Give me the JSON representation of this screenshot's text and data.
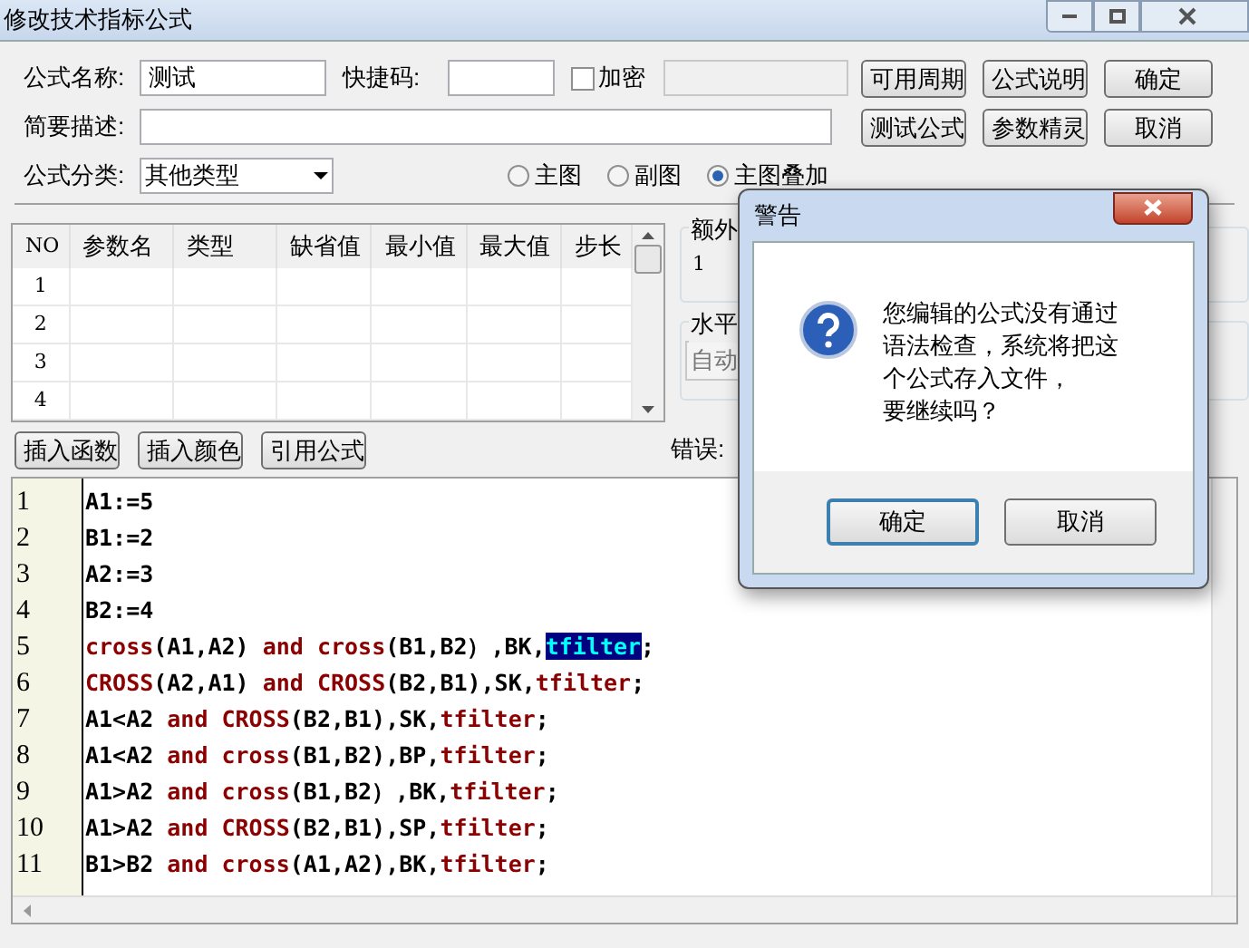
{
  "window": {
    "title": "修改技术指标公式"
  },
  "form": {
    "name_label": "公式名称:",
    "name_value": "测试",
    "shortcut_label": "快捷码:",
    "encrypt": {
      "label": "加密",
      "checked": false
    },
    "desc_label": "简要描述:",
    "category_label": "公式分类:",
    "category_value": "其他类型",
    "chart_types": [
      {
        "label": "主图",
        "selected": false
      },
      {
        "label": "副图",
        "selected": false
      },
      {
        "label": "主图叠加",
        "selected": true
      }
    ]
  },
  "buttons": [
    "可用周期",
    "公式说明",
    "确定",
    "测试公式",
    "参数精灵",
    "取消"
  ],
  "param_table": {
    "columns": [
      "NO",
      "参数名",
      "类型",
      "缺省值",
      "最小值",
      "最大值",
      "步长"
    ],
    "rows": [
      "1",
      "2",
      "3",
      "4"
    ]
  },
  "side": {
    "extra_label": "额外",
    "extra_value": "1",
    "horizontal_label": "水平",
    "auto_value": "自动",
    "error_label": "错误:"
  },
  "insert_buttons": [
    "插入函数",
    "插入颜色",
    "引用公式"
  ],
  "editor": {
    "lines": [
      {
        "number": "1",
        "tokens": [
          {
            "text": "A1:=5",
            "kind": "plain"
          }
        ]
      },
      {
        "number": "2",
        "tokens": [
          {
            "text": "B1:=2",
            "kind": "plain"
          }
        ]
      },
      {
        "number": "3",
        "tokens": [
          {
            "text": "A2:=3",
            "kind": "plain"
          }
        ]
      },
      {
        "number": "4",
        "tokens": [
          {
            "text": "B2:=4",
            "kind": "plain"
          }
        ]
      },
      {
        "number": "5",
        "tokens": [
          {
            "text": "cross",
            "kind": "keyword"
          },
          {
            "text": "(A1,A2) ",
            "kind": "plain"
          },
          {
            "text": "and",
            "kind": "keyword"
          },
          {
            "text": " cross",
            "kind": "keyword"
          },
          {
            "text": "(B1,B2）,BK,",
            "kind": "plain"
          },
          {
            "text": "tfilter",
            "kind": "selected"
          },
          {
            "text": ";",
            "kind": "plain"
          }
        ]
      },
      {
        "number": "6",
        "tokens": [
          {
            "text": "CROSS",
            "kind": "keyword"
          },
          {
            "text": "(A2,A1) ",
            "kind": "plain"
          },
          {
            "text": "and",
            "kind": "keyword"
          },
          {
            "text": " CROSS",
            "kind": "keyword"
          },
          {
            "text": "(B2,B1),SK,",
            "kind": "plain"
          },
          {
            "text": "tfilter",
            "kind": "keyword"
          },
          {
            "text": ";",
            "kind": "plain"
          }
        ]
      },
      {
        "number": "7",
        "tokens": [
          {
            "text": "A1<A2 ",
            "kind": "plain"
          },
          {
            "text": "and CROSS",
            "kind": "keyword"
          },
          {
            "text": "(B2,B1),SK,",
            "kind": "plain"
          },
          {
            "text": "tfilter",
            "kind": "keyword"
          },
          {
            "text": ";",
            "kind": "plain"
          }
        ]
      },
      {
        "number": "8",
        "tokens": [
          {
            "text": "A1<A2 ",
            "kind": "plain"
          },
          {
            "text": "and cross",
            "kind": "keyword"
          },
          {
            "text": "(B1,B2),BP,",
            "kind": "plain"
          },
          {
            "text": "tfilter",
            "kind": "keyword"
          },
          {
            "text": ";",
            "kind": "plain"
          }
        ]
      },
      {
        "number": "9",
        "tokens": [
          {
            "text": "A1>A2 ",
            "kind": "plain"
          },
          {
            "text": "and cross",
            "kind": "keyword"
          },
          {
            "text": "(B1,B2）,BK,",
            "kind": "plain"
          },
          {
            "text": "tfilter",
            "kind": "keyword"
          },
          {
            "text": ";",
            "kind": "plain"
          }
        ]
      },
      {
        "number": "10",
        "tokens": [
          {
            "text": "A1>A2 ",
            "kind": "plain"
          },
          {
            "text": "and CROSS",
            "kind": "keyword"
          },
          {
            "text": "(B2,B1),SP,",
            "kind": "plain"
          },
          {
            "text": "tfilter",
            "kind": "keyword"
          },
          {
            "text": ";",
            "kind": "plain"
          }
        ]
      },
      {
        "number": "11",
        "tokens": [
          {
            "text": "B1>B2 ",
            "kind": "plain"
          },
          {
            "text": "and cross",
            "kind": "keyword"
          },
          {
            "text": "(A1,A2),BK,",
            "kind": "plain"
          },
          {
            "text": "tfilter",
            "kind": "keyword"
          },
          {
            "text": ";",
            "kind": "plain"
          }
        ]
      }
    ]
  },
  "dialog": {
    "title": "警告",
    "message_lines": [
      "您编辑的公式没有通过",
      "语法检查，系统将把这",
      "个公式存入文件，",
      "要继续吗？"
    ],
    "buttons": [
      {
        "label": "确定",
        "selected": true
      },
      {
        "label": "取消",
        "selected": false
      }
    ]
  }
}
